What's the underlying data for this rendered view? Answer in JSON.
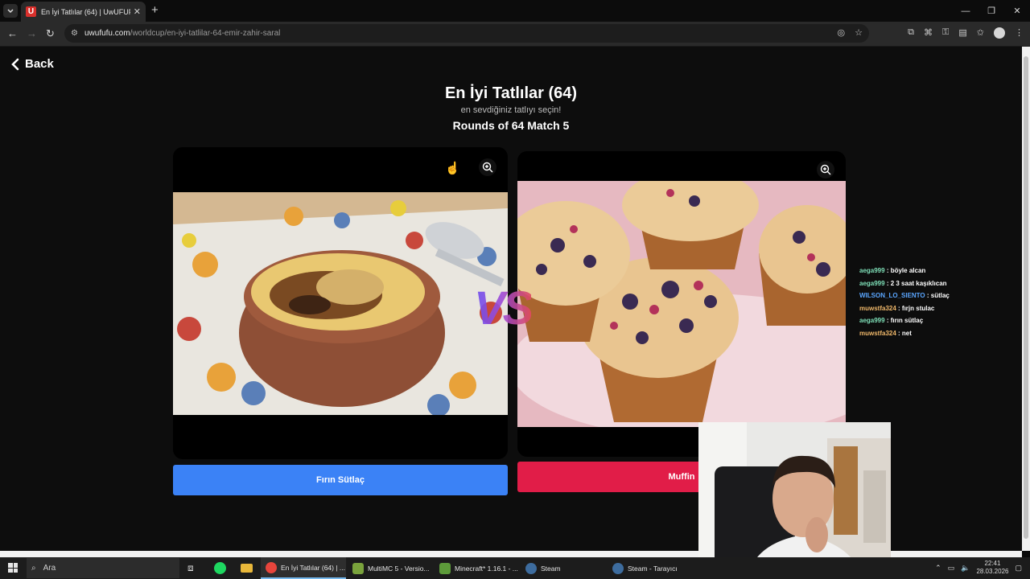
{
  "browser": {
    "tab_title": "En İyi Tatlılar (64) | UwUFUFU",
    "favicon_letter": "U",
    "url_host": "uwufufu.com",
    "url_path": "/worldcup/en-iyi-tatlilar-64-emir-zahir-saral",
    "window_controls": [
      "—",
      "❐",
      "✕"
    ]
  },
  "page": {
    "back_label": "Back",
    "title": "En İyi Tatlılar (64)",
    "subtitle": "en sevdiğiniz tatlıyı seçin!",
    "round_label": "Rounds of 64 Match 5",
    "vs_label": "VS",
    "left_choice": {
      "button_label": "Fırın Sütlaç",
      "color": "#3b82f6"
    },
    "right_choice": {
      "button_label": "Muffin",
      "color": "#e11d48"
    }
  },
  "chat": [
    {
      "user": "aega999",
      "text": " : böyle alcan",
      "color": "#7fe0b8"
    },
    {
      "user": "aega999",
      "text": " : 2 3 saat kaşıklıcan",
      "color": "#7fe0b8"
    },
    {
      "user": "WILSON_LO_SIENTO",
      "text": " : sütlaç",
      "color": "#5aa6ff"
    },
    {
      "user": "muwstfa324",
      "text": " : fırjn stulac",
      "color": "#f0b86a"
    },
    {
      "user": "aega999",
      "text": " : fırın sütlaç",
      "color": "#7fe0b8"
    },
    {
      "user": "muwstfa324",
      "text": " : net",
      "color": "#f0b86a"
    }
  ],
  "taskbar": {
    "search_placeholder": "Ara",
    "items": [
      {
        "label": "En İyi Tatlılar (64) | ...",
        "icon_color": "#e8453c"
      },
      {
        "label": "MultiMC 5 - Versio...",
        "icon_color": "#7aa33c"
      },
      {
        "label": "Minecraft* 1.16.1 - ...",
        "icon_color": "#5d9b3a"
      },
      {
        "label": "Steam",
        "icon_color": "#1b2838"
      },
      {
        "label": "Steam - Tarayıcı",
        "icon_color": "#1b2838"
      }
    ],
    "time": "22:41",
    "date": "28.03.2026"
  }
}
